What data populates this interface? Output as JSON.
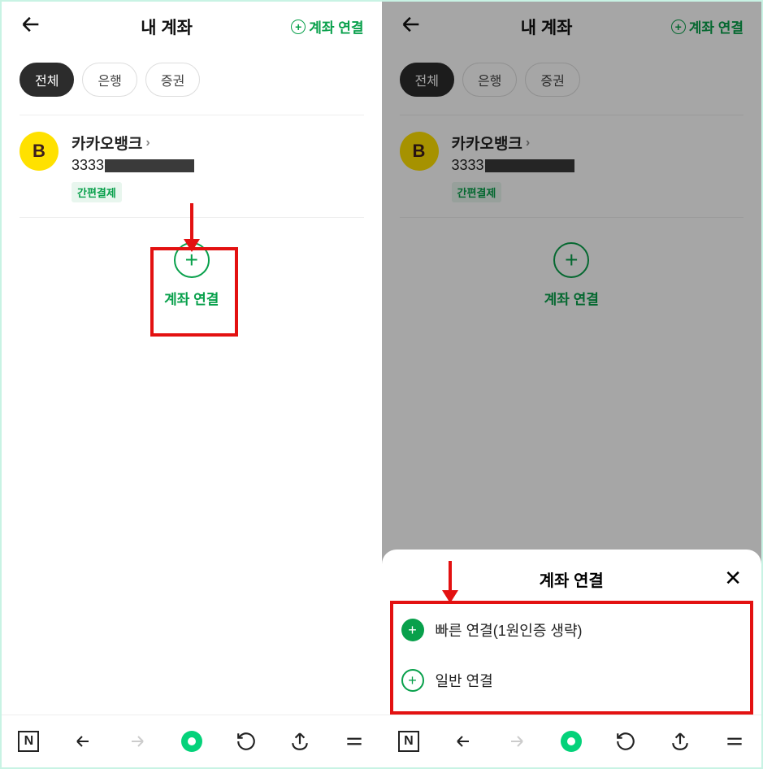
{
  "left": {
    "header": {
      "title": "내 계좌",
      "action": "계좌 연결"
    },
    "filters": [
      "전체",
      "은행",
      "증권"
    ],
    "account": {
      "avatar_letter": "B",
      "name": "카카오뱅크",
      "number_prefix": "3333",
      "badge": "간편결제"
    },
    "add": {
      "label": "계좌 연결"
    }
  },
  "right": {
    "header": {
      "title": "내 계좌",
      "action": "계좌 연결"
    },
    "filters": [
      "전체",
      "은행",
      "증권"
    ],
    "account": {
      "avatar_letter": "B",
      "name": "카카오뱅크",
      "number_prefix": "3333",
      "badge": "간편결제"
    },
    "add": {
      "label": "계좌 연결"
    },
    "sheet": {
      "title": "계좌 연결",
      "options": [
        {
          "label": "빠른 연결(1원인증 생략)",
          "style": "solid"
        },
        {
          "label": "일반 연결",
          "style": "outline"
        }
      ]
    }
  },
  "nav": {
    "home_letter": "N"
  },
  "colors": {
    "accent": "#08a04b",
    "annotation": "#e31111"
  }
}
